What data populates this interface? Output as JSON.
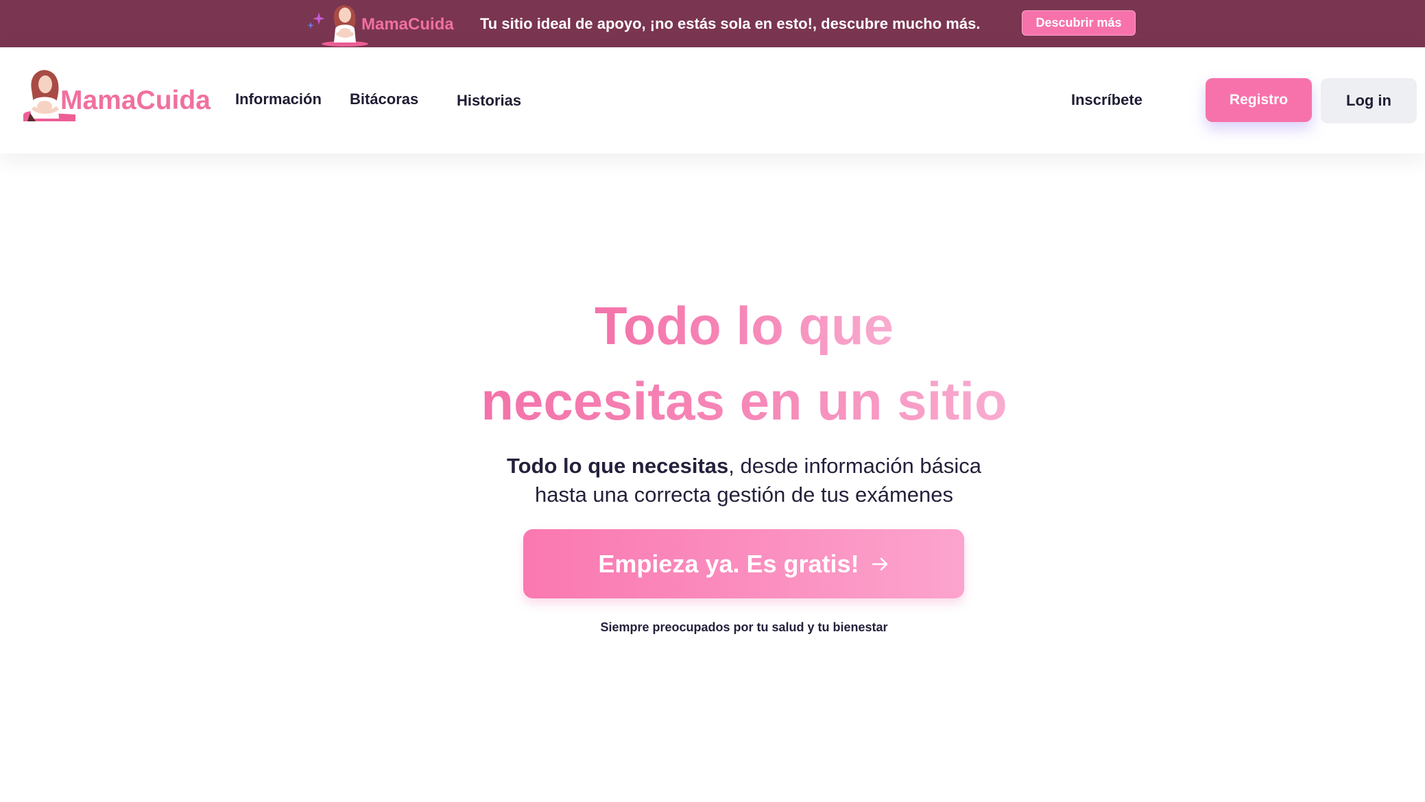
{
  "promo": {
    "brand": "MamaCuida",
    "message": "Tu sitio ideal de apoyo, ¡no estás sola en esto!, descubre mucho más.",
    "button_label": "Descubrir más"
  },
  "header": {
    "brand": "MamaCuida",
    "nav": [
      {
        "label": "Información"
      },
      {
        "label": "Bitácoras"
      },
      {
        "label": "Historias"
      }
    ],
    "signup_link": "Inscríbete",
    "register_button": "Registro",
    "login_button": "Log in"
  },
  "hero": {
    "title_line1": "Todo lo que",
    "title_line2": "necesitas en un sitio",
    "subtitle_bold": "Todo lo que necesitas",
    "subtitle_rest1": ", desde información básica",
    "subtitle_line2": "hasta una correcta gestión de tus exámenes",
    "cta_label": "Empieza ya. Es gratis!",
    "tagline": "Siempre preocupados por tu salud y tu bienestar"
  },
  "colors": {
    "banner_bg": "#7a3550",
    "brand_pink": "#f0709f",
    "button_pink": "#f772ab",
    "text_dark": "#1f1d33",
    "login_bg": "#eeeff3"
  },
  "icons": {
    "promo_sparkles": "sparkles-icon",
    "mascot": "mother-baby-logo",
    "cta_arrow": "arrow-right-icon"
  }
}
